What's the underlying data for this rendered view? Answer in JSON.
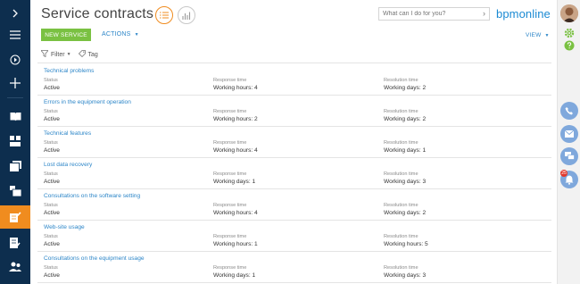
{
  "header": {
    "title": "Service contracts",
    "search_placeholder": "What can I do for you?",
    "search_arrow": "›",
    "brand": "bpmonline"
  },
  "toolbar": {
    "new_label": "NEW SERVICE",
    "actions_label": "ACTIONS",
    "view_label": "VIEW"
  },
  "filters": {
    "filter_label": "Filter",
    "tag_label": "Tag"
  },
  "columns": {
    "status": "Status",
    "response": "Response time",
    "resolution": "Resolution time"
  },
  "rows": [
    {
      "title": "Technical problems",
      "status": "Active",
      "response": "Working hours: 4",
      "resolution": "Working days: 2"
    },
    {
      "title": "Errors in the equipment operation",
      "status": "Active",
      "response": "Working hours: 2",
      "resolution": "Working days: 2"
    },
    {
      "title": "Technical features",
      "status": "Active",
      "response": "Working hours: 4",
      "resolution": "Working days: 1"
    },
    {
      "title": "Lost data recovery",
      "status": "Active",
      "response": "Working days: 1",
      "resolution": "Working days: 3"
    },
    {
      "title": "Consultations on the software setting",
      "status": "Active",
      "response": "Working hours: 4",
      "resolution": "Working days: 2"
    },
    {
      "title": "Web-site usage",
      "status": "Active",
      "response": "Working hours: 1",
      "resolution": "Working hours: 5"
    },
    {
      "title": "Consultations on the equipment usage",
      "status": "Active",
      "response": "Working days: 1",
      "resolution": "Working days: 3"
    }
  ],
  "rightbar": {
    "notification_count": "25"
  },
  "colors": {
    "sidebar": "#0d2e4e",
    "accent": "#f08c1f",
    "link": "#2d86c8",
    "new_button": "#7ac142",
    "brand": "#1b8ad3"
  },
  "icons": {
    "left": [
      "chevron-right-icon",
      "menu-icon",
      "play-icon",
      "plus-icon",
      "book-icon",
      "dashboard-icon",
      "documents-icon",
      "files-icon",
      "contract-icon",
      "document-edit-icon",
      "people-icon"
    ],
    "right": [
      "avatar",
      "gear-icon",
      "help-icon",
      "phone-icon",
      "email-icon",
      "chat-icon",
      "bell-icon"
    ]
  }
}
